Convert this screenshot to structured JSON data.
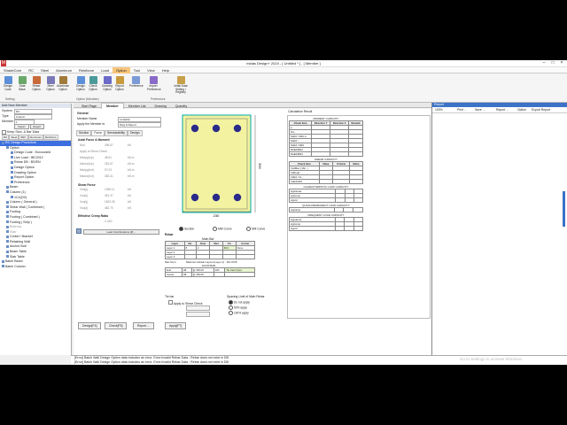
{
  "window": {
    "title": "midas Design+ 2024 - [ Untitled * ] - [ Member ]"
  },
  "menu": [
    "ShadeCore",
    "RC",
    "Steel",
    "Aluminum",
    "Reinforce",
    "Load",
    "Option",
    "Tool",
    "View",
    "Help"
  ],
  "menu_active": "Option",
  "ribbon": {
    "buttons": [
      "Design Code",
      "Data Base",
      "Rebar Option",
      "Steel Option",
      "Aluminum Option",
      "Design Option",
      "Check Option",
      "Drawing Option",
      "Report Option",
      "Preference",
      "Import Preference",
      "Initial Data Setting / Registry"
    ],
    "groups": [
      "Setting",
      "Option (Member)",
      "Preference"
    ]
  },
  "left": {
    "title": "Add New Member",
    "system_label": "System",
    "system_value": "RC",
    "type_label": "Type",
    "type_value": "Column",
    "member_label": "Member",
    "member_value": "1",
    "import_label": "Import",
    "export_label": "Export",
    "keep_label": "Keep Sect. & Bar Data",
    "tabs": [
      "RC",
      "Steel",
      "SRC",
      "Aluminum",
      "Reinforce"
    ],
    "tree": [
      {
        "label": "RC Design Procedure",
        "sel": true,
        "dim": false,
        "indent": 0
      },
      {
        "label": "Option",
        "sel": false,
        "dim": false,
        "indent": 1
      },
      {
        "label": "Design Code : Eurocoded",
        "sel": false,
        "dim": false,
        "indent": 2
      },
      {
        "label": "Live Load : IBC2012",
        "sel": false,
        "dim": false,
        "indent": 2
      },
      {
        "label": "Rebar DB : BS/EN",
        "sel": false,
        "dim": false,
        "indent": 2
      },
      {
        "label": "Design Option",
        "sel": false,
        "dim": false,
        "indent": 2
      },
      {
        "label": "Drawing Option",
        "sel": false,
        "dim": false,
        "indent": 2
      },
      {
        "label": "Report Option",
        "sel": false,
        "dim": false,
        "indent": 2
      },
      {
        "label": "Preference",
        "sel": false,
        "dim": false,
        "indent": 2
      },
      {
        "label": "Beam",
        "sel": false,
        "dim": false,
        "indent": 1
      },
      {
        "label": "Column (1)",
        "sel": false,
        "dim": false,
        "indent": 1
      },
      {
        "label": "1C4(2/0)",
        "sel": false,
        "dim": false,
        "indent": 2
      },
      {
        "label": "Column ( General )",
        "sel": false,
        "dim": false,
        "indent": 1
      },
      {
        "label": "Shear Wall ( Combined )",
        "sel": false,
        "dim": false,
        "indent": 1
      },
      {
        "label": "Footing",
        "sel": false,
        "dim": false,
        "indent": 1
      },
      {
        "label": "Footing ( Combined )",
        "sel": false,
        "dim": false,
        "indent": 1
      },
      {
        "label": "Footing ( Strip )",
        "sel": false,
        "dim": false,
        "indent": 1
      },
      {
        "label": "Buttress",
        "sel": false,
        "dim": true,
        "indent": 1
      },
      {
        "label": "Stair",
        "sel": false,
        "dim": true,
        "indent": 1
      },
      {
        "label": "Corbel / Bracket",
        "sel": false,
        "dim": false,
        "indent": 1
      },
      {
        "label": "Retaining Wall",
        "sel": false,
        "dim": false,
        "indent": 1
      },
      {
        "label": "Anchor Bolt",
        "sel": false,
        "dim": false,
        "indent": 1
      },
      {
        "label": "Beam Table",
        "sel": false,
        "dim": false,
        "indent": 1
      },
      {
        "label": "Slab Table",
        "sel": false,
        "dim": false,
        "indent": 1
      },
      {
        "label": "Batch Beam",
        "sel": false,
        "dim": false,
        "indent": 0
      },
      {
        "label": "Batch Column",
        "sel": false,
        "dim": false,
        "indent": 0
      }
    ]
  },
  "doc_tabs": [
    "Start Page",
    "Member",
    "Member List",
    "Drawing",
    "Quantity"
  ],
  "doc_active": "Member",
  "form": {
    "general_label": "General",
    "member_name_label": "Member Name",
    "member_name_value": "1C4(2/0)",
    "apply_label": "Apply the Member to",
    "apply_value": "Dwg & Report",
    "section_tabs": [
      "Section",
      "Force",
      "Serviceability",
      "Design"
    ],
    "axial_title": "Axial Force & Moment",
    "axial_rows": [
      [
        "Nsd",
        "396.67",
        "kN"
      ],
      [
        "Apply to Shear Check",
        "",
        ""
      ],
      [
        "Msdyy(top)",
        "48.61",
        "kN.m"
      ],
      [
        "Msdzz(top)",
        "281.67",
        "kN.m"
      ],
      [
        "Msdyy(bot)",
        "97.03",
        "kN.m"
      ],
      [
        "Msdzz(bot)",
        "383.41",
        "kN.m"
      ]
    ],
    "shear_title": "Shear Force",
    "shear_rows": [
      [
        "Vsd(y)",
        "1398.11",
        "kN"
      ],
      [
        "Vsd(z)",
        "391.37",
        "kN"
      ],
      [
        "Vsd(y)",
        "1603.38",
        "kN"
      ],
      [
        "Vsd(z)",
        "482.70",
        "kN"
      ]
    ],
    "creep_title": "Effective Creep Ratio",
    "creep_value": "2.440",
    "load_combo_btn": "Load Combinations [#] ...",
    "radio_options": [
      "Section",
      "MM Curve",
      "NM Curve"
    ],
    "rebar_title": "Rebar",
    "rebar_table_head": [
      "Layer",
      "No.",
      "Row",
      "Rwt",
      "Ch",
      "Corner"
    ],
    "rebar_table_rows": [
      [
        "Layer 1",
        "8",
        "2",
        "",
        "60.0",
        "None"
      ],
      [
        "Layer 2",
        "",
        "",
        "",
        "",
        ""
      ],
      [
        "Layer 3",
        "",
        "",
        "",
        "",
        ""
      ]
    ],
    "main_bar_label": "Main Bar",
    "max_num_label": "Max Num.",
    "max_num_note": "Maximum Rebar Layout (Layer 1) : 18 H P25",
    "hoop_label": "HOOP BAR",
    "hoop_rows": [
      [
        "End",
        "H8",
        "@ 150.00",
        "100",
        "Tie User Input"
      ],
      [
        "Center",
        "H8",
        "@ 150.00",
        "",
        ""
      ]
    ],
    "tie_bar_label": "Tie bar",
    "apply_shear_label": "Apply to Shear Check",
    "spacing_label": "Spacing Limit of Main Rebar",
    "spacing_options": [
      "Do not apply",
      "50% apply",
      "100% apply"
    ],
    "section_dim_w": "230",
    "section_dim_h": "300",
    "bottom_buttons": [
      "Design[F4]",
      "Check[F5]",
      "Report ...",
      "Apply[F7]"
    ]
  },
  "calc": {
    "title": "Calculation Result",
    "moment_title": "MOMENT CAPACITY",
    "moment_head": [
      "Check Item",
      "Direction Y",
      "Direction Z",
      "Remark"
    ],
    "moment_rows": [
      "φ",
      "Nrs",
      "NsRd / NRd,m",
      "NsRd /",
      "NsRd / NRd",
      "MsEd/MRd",
      "MsEd/MRd"
    ],
    "shear_title": "SHEAR CAPACITY",
    "shear_head": [
      "Check Item",
      "Value",
      "Criteria",
      "Ratio"
    ],
    "shear_rows": [
      "VsdMax ( Min. )",
      "VsReqd",
      "VsRd / Vs",
      "VsEd/VRd"
    ],
    "char_title": "CHARACTERISTIC LOAD CAPACITY",
    "char_rows": [
      "sigCamax",
      "sigComp",
      "sigLtd"
    ],
    "quasi_title": "QUASI-PERMANENT LOAD CAPACITY",
    "quasi_rows": [
      "sigCamp"
    ],
    "freq_title": "FREQUENT LOAD CAPACITY",
    "freq_rows": [
      "sigLdemtr",
      "sigComp",
      "sigLtd"
    ]
  },
  "report": {
    "title": "Report",
    "zoom": "100%",
    "toolbar": [
      "Print ...",
      "Save ...",
      "Report ...",
      "Option",
      "Export Report"
    ]
  },
  "messages": [
    "[Error] Batch Wall Design Option data includes an error. Error:Invalid Rebar Data : Rebar does not exist in DB",
    "[Error] Batch Wall Design Option data includes an error. Error:Invalid Rebar Data : Rebar does not exist in DB"
  ],
  "watermark": "Go to Settings to activate Windows.",
  "colors": {
    "accent": "#f8c57a",
    "selection": "#3b6ee0",
    "rebar": "#2a2a8a",
    "section_fill": "#f2f2a0",
    "section_edge": "#00aaaa"
  }
}
